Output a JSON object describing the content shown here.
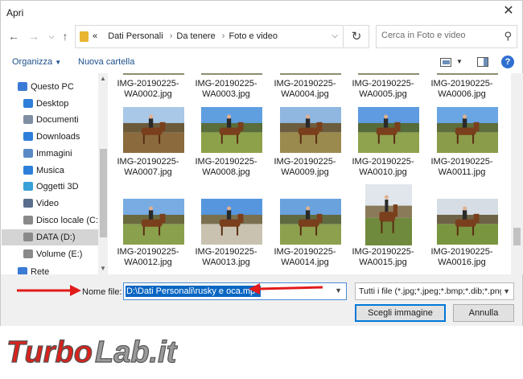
{
  "window": {
    "title": "Apri",
    "close_icon": "close-icon"
  },
  "address_bar": {
    "breadcrumbs": [
      "Dati Personali",
      "Da tenere",
      "Foto e video"
    ],
    "overflow_marker": "«",
    "search_placeholder": "Cerca in Foto e video"
  },
  "toolbar": {
    "organize_label": "Organizza",
    "new_folder_label": "Nuova cartella"
  },
  "nav_pane": {
    "items": [
      {
        "label": "Questo PC",
        "icon": "computer-icon",
        "color": "#3a7bd5"
      },
      {
        "label": "Desktop",
        "icon": "desktop-icon",
        "color": "#2e7fd9"
      },
      {
        "label": "Documenti",
        "icon": "documents-icon",
        "color": "#7f8ea3"
      },
      {
        "label": "Downloads",
        "icon": "downloads-icon",
        "color": "#2e7fd9"
      },
      {
        "label": "Immagini",
        "icon": "pictures-icon",
        "color": "#5b8ac6"
      },
      {
        "label": "Musica",
        "icon": "music-icon",
        "color": "#2e7fd9"
      },
      {
        "label": "Oggetti 3D",
        "icon": "3d-objects-icon",
        "color": "#39a0d8"
      },
      {
        "label": "Video",
        "icon": "videos-icon",
        "color": "#5a6e8c"
      },
      {
        "label": "Disco locale (C:)",
        "icon": "disk-icon",
        "color": "#8a8a8a"
      },
      {
        "label": "DATA (D:)",
        "icon": "disk-icon",
        "color": "#8a8a8a",
        "selected": true
      },
      {
        "label": "Volume (E:)",
        "icon": "disk-icon",
        "color": "#8a8a8a"
      },
      {
        "label": "Rete",
        "icon": "network-icon",
        "color": "#3a7bd5"
      }
    ]
  },
  "files": [
    {
      "name": [
        "IMG-20190225-",
        "WA0002.jpg"
      ],
      "partial": true
    },
    {
      "name": [
        "IMG-20190225-",
        "WA0003.jpg"
      ],
      "partial": true
    },
    {
      "name": [
        "IMG-20190225-",
        "WA0004.jpg"
      ],
      "partial": true
    },
    {
      "name": [
        "IMG-20190225-",
        "WA0005.jpg"
      ],
      "partial": true
    },
    {
      "name": [
        "IMG-20190225-",
        "WA0006.jpg"
      ],
      "partial": true
    },
    {
      "name": [
        "IMG-20190225-",
        "WA0007.jpg"
      ],
      "sky": "#a9c7e6",
      "ground": "#8b6a3e",
      "trees": "#6b5a3a",
      "orientation": "landscape"
    },
    {
      "name": [
        "IMG-20190225-",
        "WA0008.jpg"
      ],
      "sky": "#5f9fe0",
      "ground": "#8da14a",
      "trees": "#5a6d3a",
      "orientation": "landscape"
    },
    {
      "name": [
        "IMG-20190225-",
        "WA0009.jpg"
      ],
      "sky": "#8fb7e0",
      "ground": "#9b8a4e",
      "trees": "#6c5d3e",
      "orientation": "landscape"
    },
    {
      "name": [
        "IMG-20190225-",
        "WA0010.jpg"
      ],
      "sky": "#5e9be0",
      "ground": "#8fa24e",
      "trees": "#566b3a",
      "orientation": "landscape"
    },
    {
      "name": [
        "IMG-20190225-",
        "WA0011.jpg"
      ],
      "sky": "#6aa6e4",
      "ground": "#8a9c4a",
      "trees": "#5e6e3c",
      "orientation": "landscape"
    },
    {
      "name": [
        "IMG-20190225-",
        "WA0012.jpg"
      ],
      "sky": "#78ace2",
      "ground": "#8aa04c",
      "trees": "#6a6a3e",
      "orientation": "landscape"
    },
    {
      "name": [
        "IMG-20190225-",
        "WA0013.jpg"
      ],
      "sky": "#5596de",
      "ground": "#c9c2b0",
      "trees": "#7a7050",
      "orientation": "landscape"
    },
    {
      "name": [
        "IMG-20190225-",
        "WA0014.jpg"
      ],
      "sky": "#6aa2de",
      "ground": "#8ca04e",
      "trees": "#5f6a40",
      "orientation": "landscape"
    },
    {
      "name": [
        "IMG-20190225-",
        "WA0015.jpg"
      ],
      "sky": "#e0e6ec",
      "ground": "#6f8a3c",
      "trees": "#8a7a5a",
      "orientation": "portrait"
    },
    {
      "name": [
        "IMG-20190225-",
        "WA0016.jpg"
      ],
      "sky": "#d6dde4",
      "ground": "#7a9540",
      "trees": "#6e6246",
      "orientation": "landscape"
    }
  ],
  "bottom_bar": {
    "filename_label": "Nome file:",
    "filename_value": "D:\\Dati Personali\\rusky e oca.mp4",
    "filetype_value": "Tutti i file (*.jpg;*.jpeg;*.bmp;*.dib;*.png",
    "open_button": "Scegli immagine",
    "cancel_button": "Annulla"
  },
  "annotation": {
    "arrow_color": "#e21b1b"
  },
  "watermark": {
    "text_a": "Turbo",
    "text_b": "Lab.it",
    "color_a": "#d9221c",
    "color_b": "#9a9a9a"
  }
}
